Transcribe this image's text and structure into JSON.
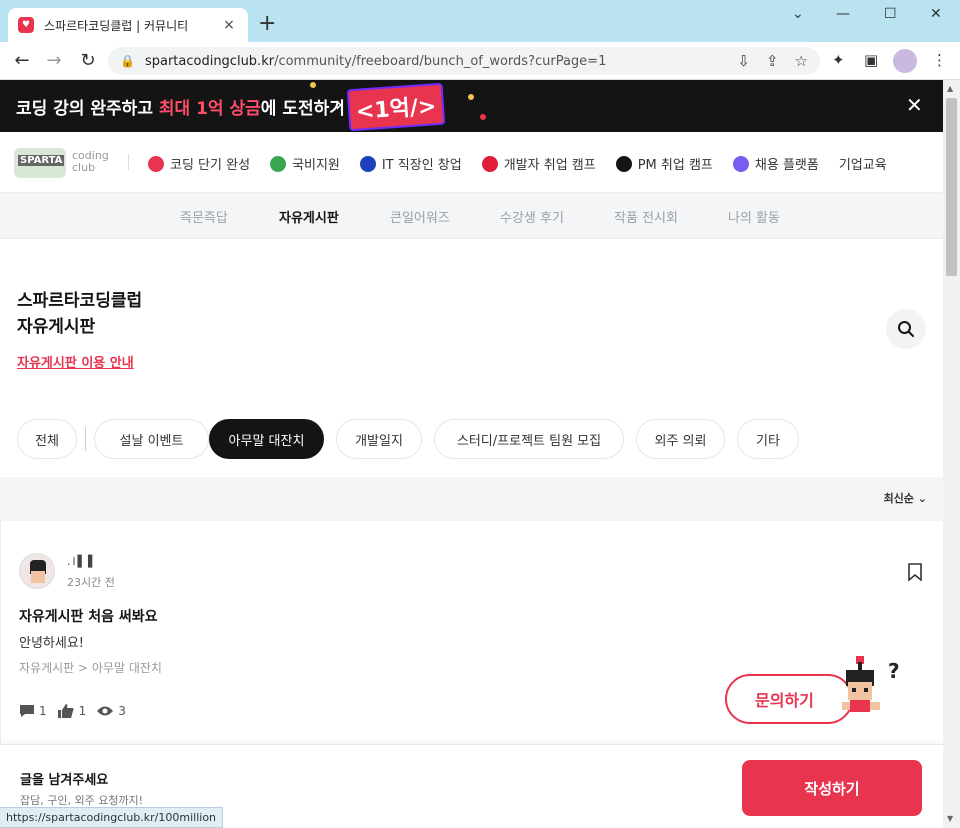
{
  "browser": {
    "tab_title": "스파르타코딩클럽 | 커뮤니티",
    "url_host": "spartacodingclub.kr",
    "url_path": "/community/freeboard/bunch_of_words?curPage=1",
    "status_url": "https://spartacodingclub.kr/100million"
  },
  "banner": {
    "text_pre": "코딩 강의 완주하고 ",
    "text_highlight": "최대 1억 상금",
    "text_post": "에 도전하기",
    "badge": "<1억/>"
  },
  "header": {
    "logo_mark": "SPARTA",
    "logo_sub1": "coding",
    "logo_sub2": "club",
    "nav": [
      {
        "label": "코딩 단기 완성",
        "color": "#e8344e"
      },
      {
        "label": "국비지원",
        "color": "#3aa652"
      },
      {
        "label": "IT 직장인 창업",
        "color": "#1f3fbf"
      },
      {
        "label": "개발자 취업 캠프",
        "color": "#e0203a"
      },
      {
        "label": "PM 취업 캠프",
        "color": "#141414"
      },
      {
        "label": "채용 플랫폼",
        "color": "#7a5cf0"
      },
      {
        "label": "기업교육",
        "color": ""
      }
    ]
  },
  "community_tabs": [
    "즉문즉답",
    "자유게시판",
    "큰일어워즈",
    "수강생 후기",
    "작품 전시회",
    "나의 활동"
  ],
  "board": {
    "title_line1": "스파르타코딩클럽",
    "title_line2": "자유게시판",
    "guide_link": "자유게시판 이용 안내"
  },
  "chips": [
    "전체",
    "설날 이벤트",
    "아무말 대잔치",
    "개발일지",
    "스터디/프로젝트 팀원 모집",
    "외주 의뢰",
    "기타"
  ],
  "sort": {
    "label": "최신순"
  },
  "post": {
    "author": ".l▌▌",
    "time": "23시간 전",
    "title": "자유게시판 처음 써봐요",
    "body": "안녕하세요!",
    "category": "자유게시판 > 아무말 대잔치",
    "comments": "1",
    "likes": "1",
    "views": "3"
  },
  "inquiry": {
    "label": "문의하기"
  },
  "writebar": {
    "heading": "글을 남겨주세요",
    "sub": "잡담, 구인, 외주 요청까지!",
    "button": "작성하기"
  }
}
